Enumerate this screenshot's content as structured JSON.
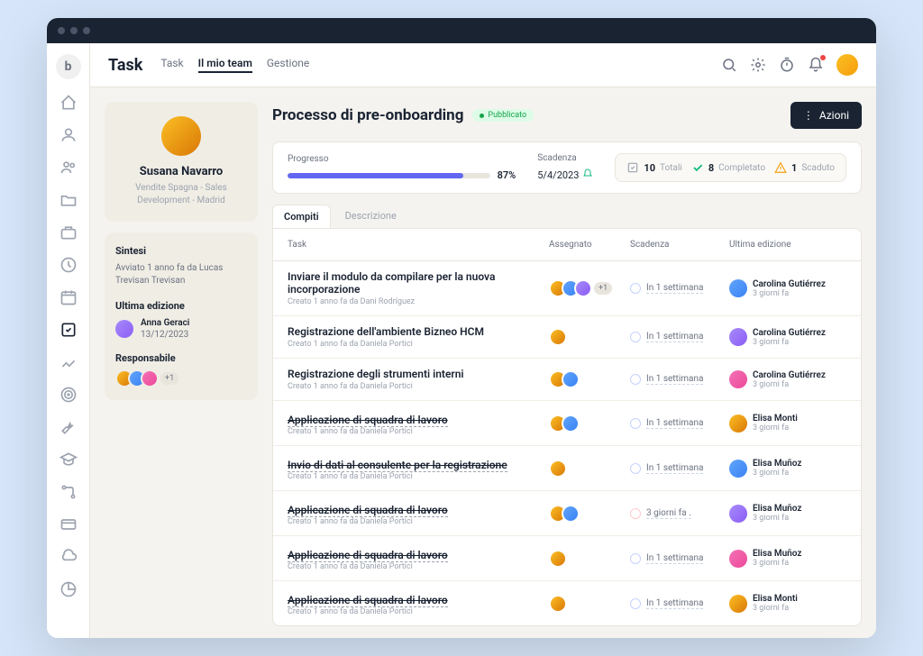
{
  "app": {
    "title": "Task",
    "tabs": [
      {
        "label": "Task",
        "active": false
      },
      {
        "label": "Il mio team",
        "active": true
      },
      {
        "label": "Gestione",
        "active": false
      }
    ]
  },
  "profile": {
    "name": "Susana Navarro",
    "subtitle": "Vendite Spagna - Sales Development - Madrid"
  },
  "sintesi": {
    "title": "Sintesi",
    "started": "Avviato 1 anno fa da Lucas Trevisan Trevisan",
    "lastEditTitle": "Ultima edizione",
    "lastEditName": "Anna Geraci",
    "lastEditDate": "13/12/2023",
    "respTitle": "Responsabile",
    "respPlus": "+1"
  },
  "process": {
    "title": "Processo di pre-onboarding",
    "status": "Pubblicato",
    "actionsBtn": "Azioni"
  },
  "metrics": {
    "progressLabel": "Progresso",
    "progressPct": "87%",
    "progressWidth": 87,
    "deadlineLabel": "Scadenza",
    "deadlineDate": "5/4/2023"
  },
  "stats": {
    "total": {
      "num": "10",
      "label": "Totali"
    },
    "completed": {
      "num": "8",
      "label": "Completato"
    },
    "overdue": {
      "num": "1",
      "label": "Scaduto"
    }
  },
  "subtabs": [
    {
      "label": "Compiti",
      "active": true
    },
    {
      "label": "Descrizione",
      "active": false
    }
  ],
  "table": {
    "headers": {
      "task": "Task",
      "assigned": "Assegnato",
      "due": "Scadenza",
      "lastEdit": "Ultima edizione"
    },
    "rows": [
      {
        "title": "Inviare il modulo da compilare per la nuova incorporazione",
        "sub": "Creato 1 anno fa da Dani Rodríguez",
        "strike": false,
        "assignees": 3,
        "plus": "+1",
        "due": "In 1 settimana",
        "dueRed": false,
        "editor": "Carolina Gutiérrez",
        "editTime": "3 giorni fa"
      },
      {
        "title": "Registrazione dell'ambiente Bizneo HCM",
        "sub": "Creato 1 anno fa da Daniela Portici",
        "strike": false,
        "assignees": 1,
        "plus": "",
        "due": "In 1 settimana",
        "dueRed": false,
        "editor": "Carolina Gutiérrez",
        "editTime": "3 giorni fa"
      },
      {
        "title": "Registrazione degli strumenti interni",
        "sub": "Creato 1 anno fa da Daniela Portici",
        "strike": false,
        "assignees": 2,
        "plus": "",
        "due": "In 1 settimana",
        "dueRed": false,
        "editor": "Carolina Gutiérrez",
        "editTime": "3 giorni fa"
      },
      {
        "title": "Applicazione di squadra di lavoro",
        "sub": "Creato 1 anno fa da Daniela Portici",
        "strike": true,
        "assignees": 2,
        "plus": "",
        "due": "In 1 settimana",
        "dueRed": false,
        "editor": "Elisa Monti",
        "editTime": "3 giorni fa"
      },
      {
        "title": "Invio di dati al consulente per la registrazione",
        "sub": "Creato 1 anno fa da Daniela Portici",
        "strike": true,
        "assignees": 1,
        "plus": "",
        "due": "In 1 settimana",
        "dueRed": false,
        "editor": "Elisa Muñoz",
        "editTime": "3 giorni fa"
      },
      {
        "title": "Applicazione di squadra di lavoro",
        "sub": "Creato 1 anno fa da Daniela Portici",
        "strike": true,
        "assignees": 2,
        "plus": "",
        "due": "3 giorni fa .",
        "dueRed": true,
        "editor": "Elisa Muñoz",
        "editTime": "3 giorni fa"
      },
      {
        "title": "Applicazione di squadra di lavoro",
        "sub": "Creato 1 anno fa da Daniela Portici",
        "strike": true,
        "assignees": 1,
        "plus": "",
        "due": "In 1 settimana",
        "dueRed": false,
        "editor": "Elisa Muñoz",
        "editTime": "3 giorni fa"
      },
      {
        "title": "Applicazione di squadra di lavoro",
        "sub": "Creato 1 anno fa da Daniela Portici",
        "strike": true,
        "assignees": 1,
        "plus": "",
        "due": "In 1 settimana",
        "dueRed": false,
        "editor": "Elisa Monti",
        "editTime": "3 giorni fa"
      }
    ]
  }
}
